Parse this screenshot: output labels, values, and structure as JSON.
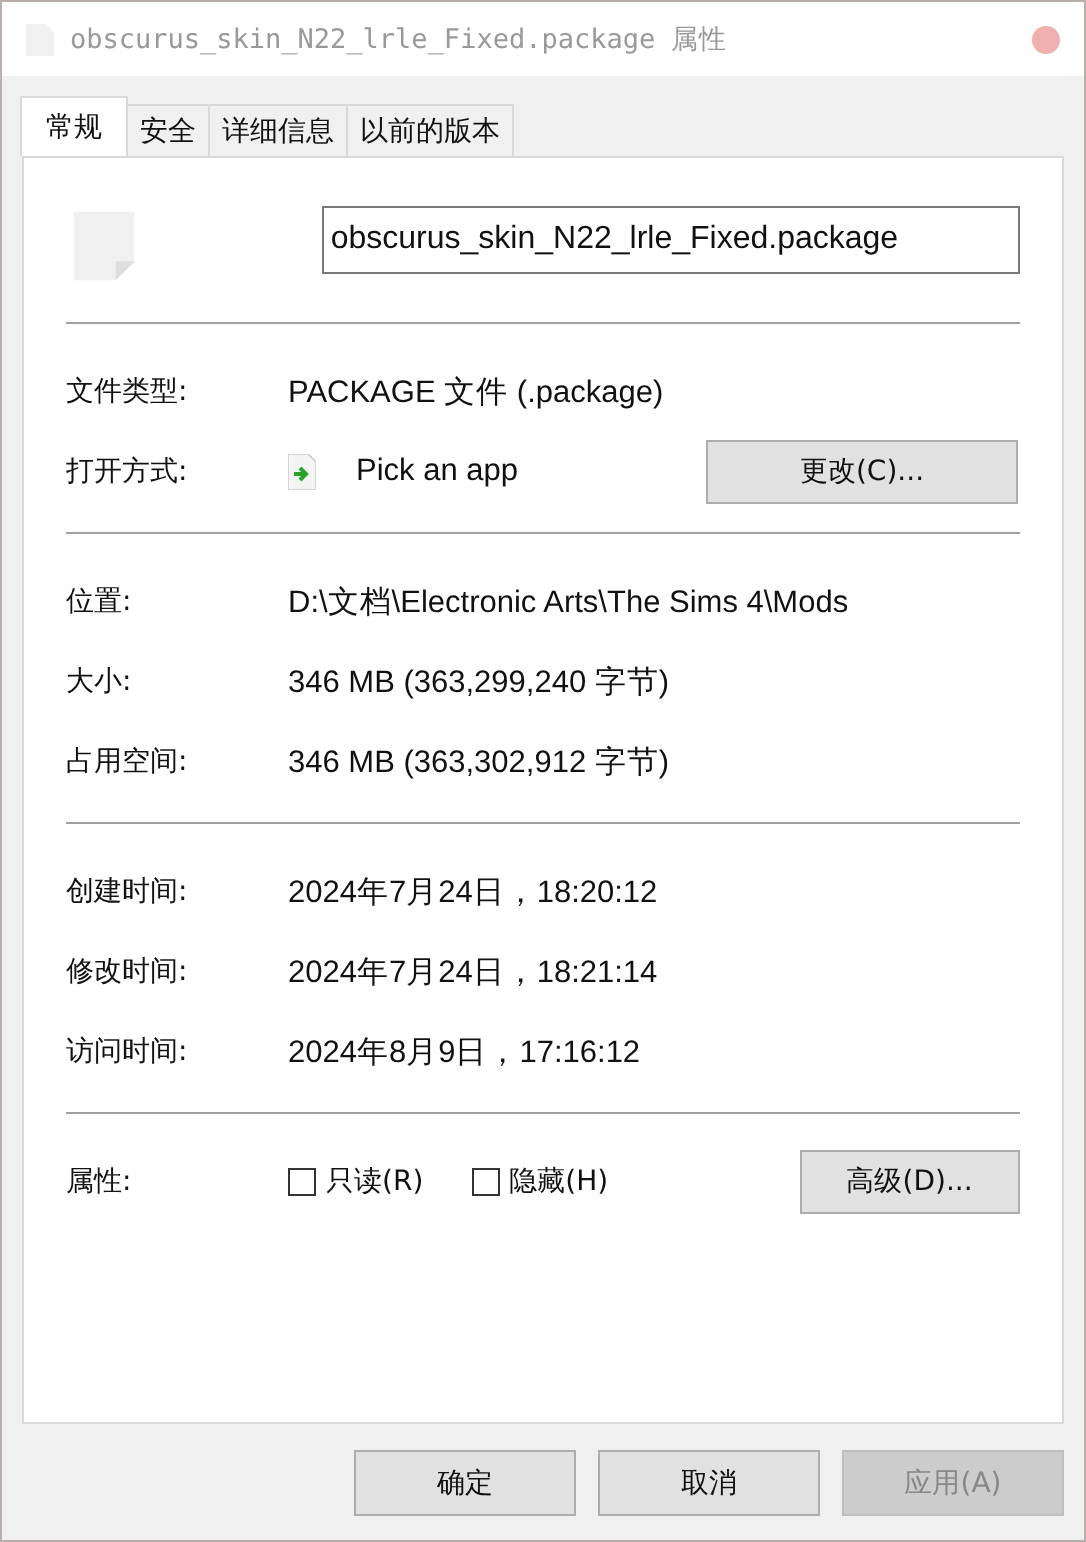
{
  "window": {
    "title": "obscurus_skin_N22_lrle_Fixed.package 属性"
  },
  "tabs": [
    {
      "label": "常规",
      "selected": true
    },
    {
      "label": "安全",
      "selected": false
    },
    {
      "label": "详细信息",
      "selected": false
    },
    {
      "label": "以前的版本",
      "selected": false
    }
  ],
  "file_name": "obscurus_skin_N22_lrle_Fixed.package",
  "groups": [
    {
      "rows": [
        {
          "kind": "text",
          "label": "文件类型:",
          "value": "PACKAGE 文件 (.package)"
        },
        {
          "kind": "app",
          "label": "打开方式:",
          "value": "Pick an app",
          "button": "更改(C)..."
        }
      ]
    },
    {
      "rows": [
        {
          "kind": "text",
          "label": "位置:",
          "value": "D:\\文档\\Electronic Arts\\The Sims 4\\Mods"
        },
        {
          "kind": "text",
          "label": "大小:",
          "value": "346 MB (363,299,240 字节)"
        },
        {
          "kind": "text",
          "label": "占用空间:",
          "value": "346 MB (363,302,912 字节)"
        }
      ]
    },
    {
      "rows": [
        {
          "kind": "text",
          "label": "创建时间:",
          "value": "2024年7月24日，18:20:12"
        },
        {
          "kind": "text",
          "label": "修改时间:",
          "value": "2024年7月24日，18:21:14"
        },
        {
          "kind": "text",
          "label": "访问时间:",
          "value": "2024年8月9日，17:16:12"
        }
      ]
    },
    {
      "rows": [
        {
          "kind": "attributes",
          "label": "属性:",
          "checkboxes": [
            {
              "label": "只读(R)",
              "checked": false
            },
            {
              "label": "隐藏(H)",
              "checked": false
            }
          ],
          "button": "高级(D)..."
        }
      ]
    }
  ],
  "buttons": [
    {
      "label": "确定",
      "disabled": false
    },
    {
      "label": "取消",
      "disabled": false
    },
    {
      "label": "应用(A)",
      "disabled": true
    }
  ]
}
